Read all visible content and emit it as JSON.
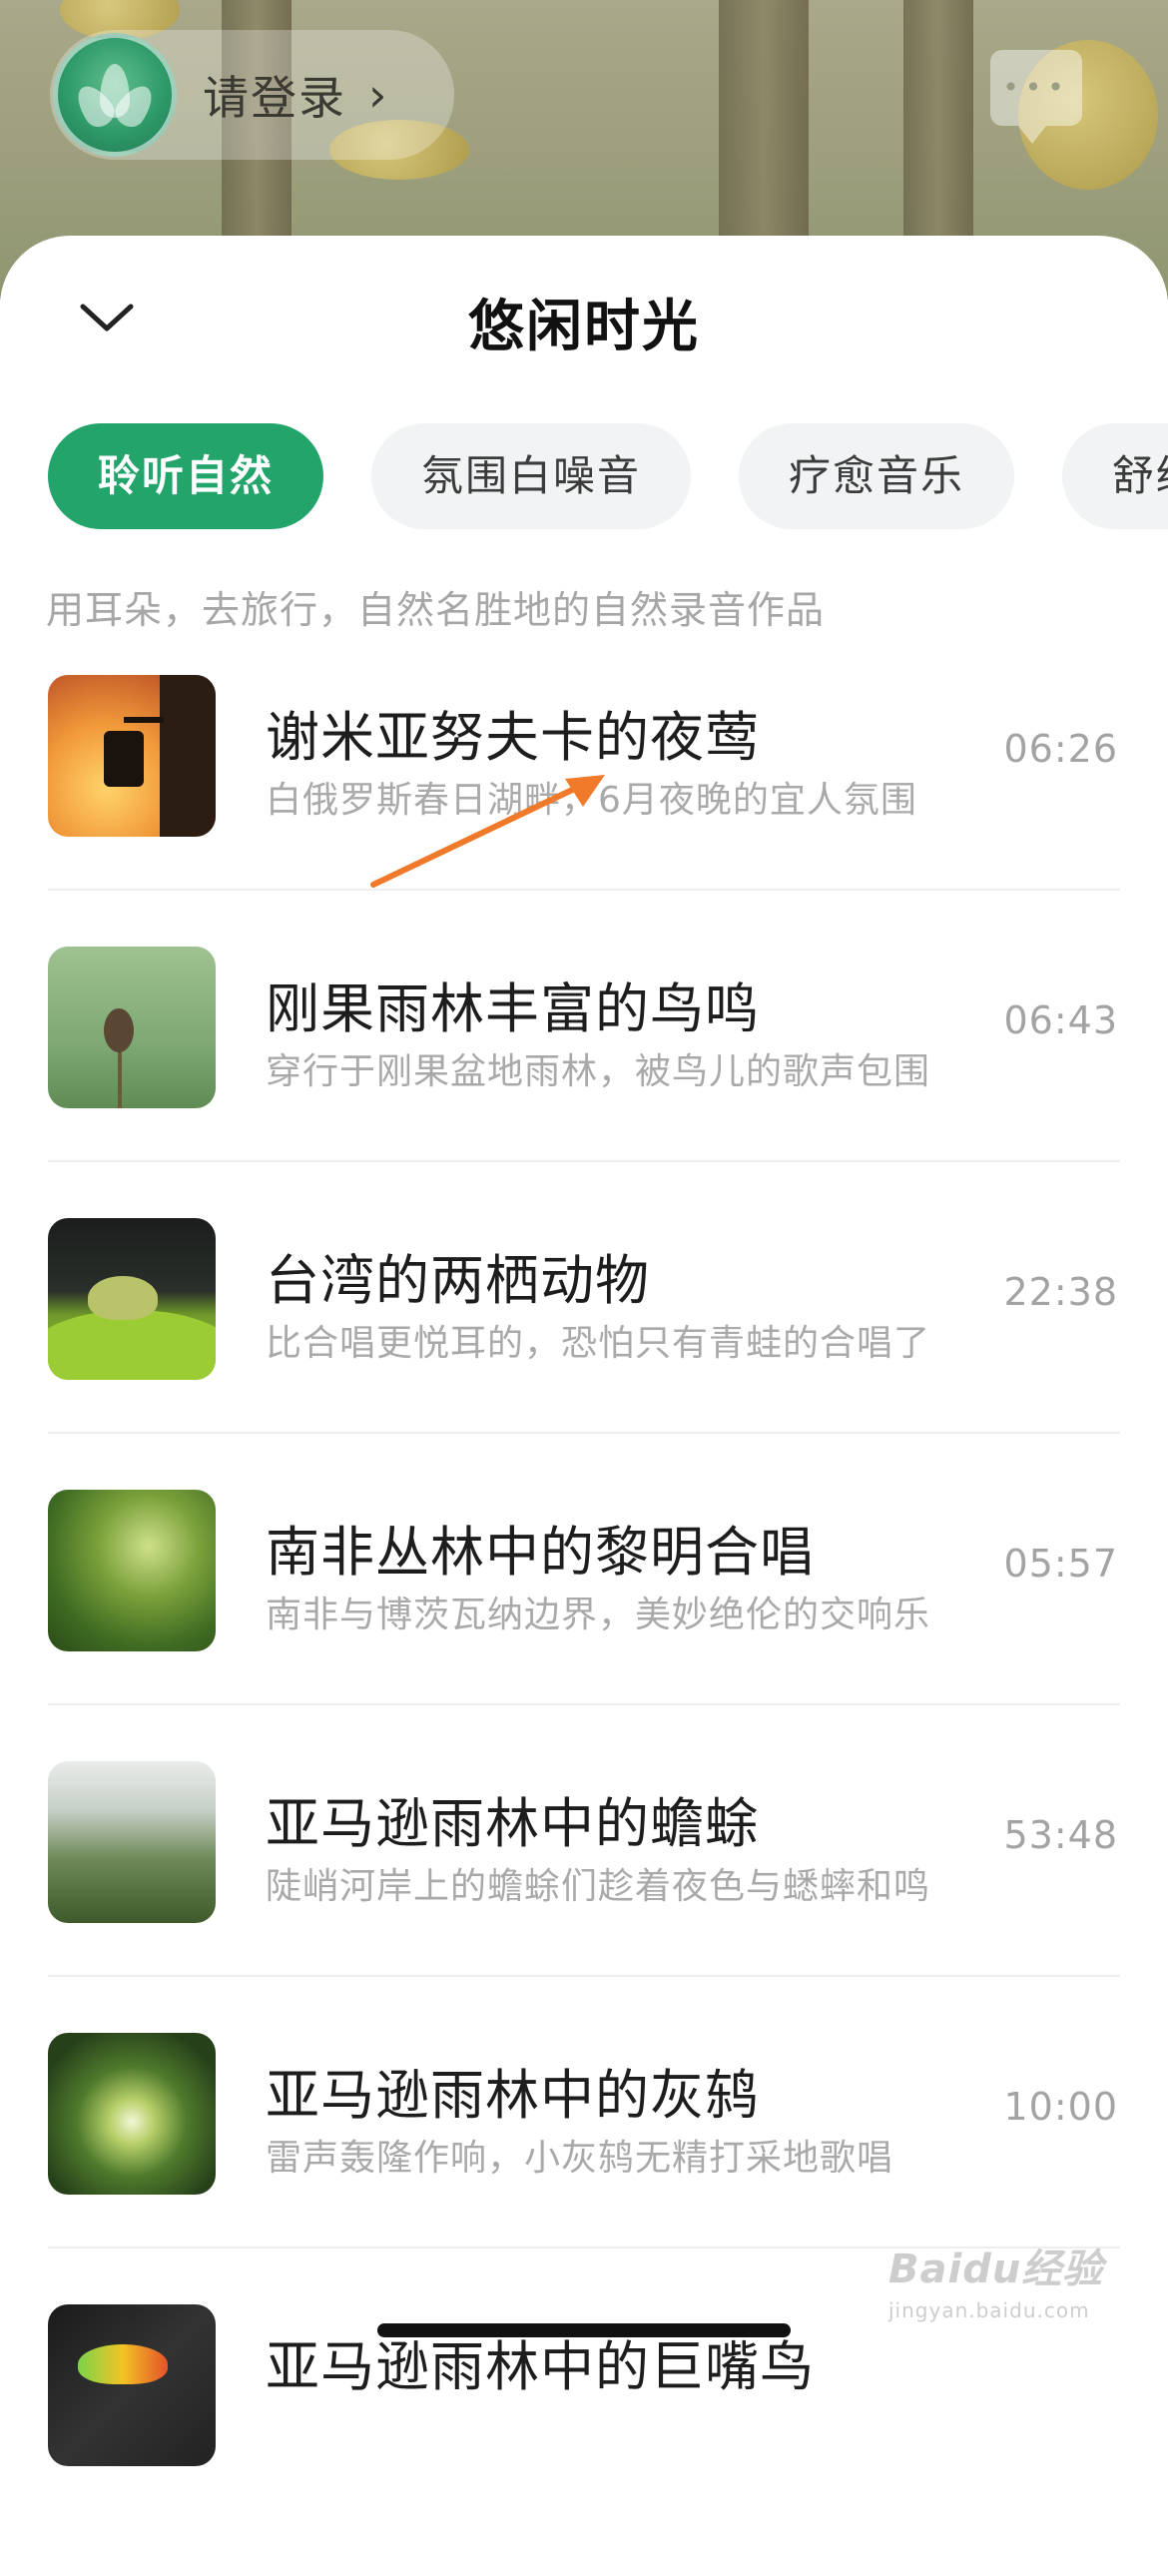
{
  "header": {
    "login_label": "请登录",
    "login_chevron": "›",
    "message_icon": "message-bubble-icon"
  },
  "sheet": {
    "title": "悠闲时光",
    "collapse_icon": "chevron-down-icon"
  },
  "tabs": [
    {
      "label": "聆听自然",
      "active": true
    },
    {
      "label": "氛围白噪音",
      "active": false
    },
    {
      "label": "疗愈音乐",
      "active": false
    },
    {
      "label": "舒缓",
      "active": false
    }
  ],
  "subtitle": "用耳朵，去旅行，自然名胜地的自然录音作品",
  "items": [
    {
      "title": "谢米亚努夫卡的夜莺",
      "desc": "白俄罗斯春日湖畔，6月夜晚的宜人氛围",
      "time": "06:26"
    },
    {
      "title": "刚果雨林丰富的鸟鸣",
      "desc": "穿行于刚果盆地雨林，被鸟儿的歌声包围",
      "time": "06:43"
    },
    {
      "title": "台湾的两栖动物",
      "desc": "比合唱更悦耳的，恐怕只有青蛙的合唱了",
      "time": "22:38"
    },
    {
      "title": "南非丛林中的黎明合唱",
      "desc": "南非与博茨瓦纳边界，美妙绝伦的交响乐",
      "time": "05:57"
    },
    {
      "title": "亚马逊雨林中的蟾蜍",
      "desc": "陡峭河岸上的蟾蜍们趁着夜色与蟋蟀和鸣",
      "time": "53:48"
    },
    {
      "title": "亚马逊雨林中的灰鸫",
      "desc": "雷声轰隆作响，小灰鸫无精打采地歌唱",
      "time": "10:00"
    },
    {
      "title": "亚马逊雨林中的巨嘴鸟",
      "desc": "",
      "time": ""
    }
  ],
  "watermark": {
    "main": "Baidu经验",
    "sub": "jingyan.baidu.com"
  },
  "colors": {
    "accent": "#22a46b",
    "arrow": "#f07a2a"
  }
}
